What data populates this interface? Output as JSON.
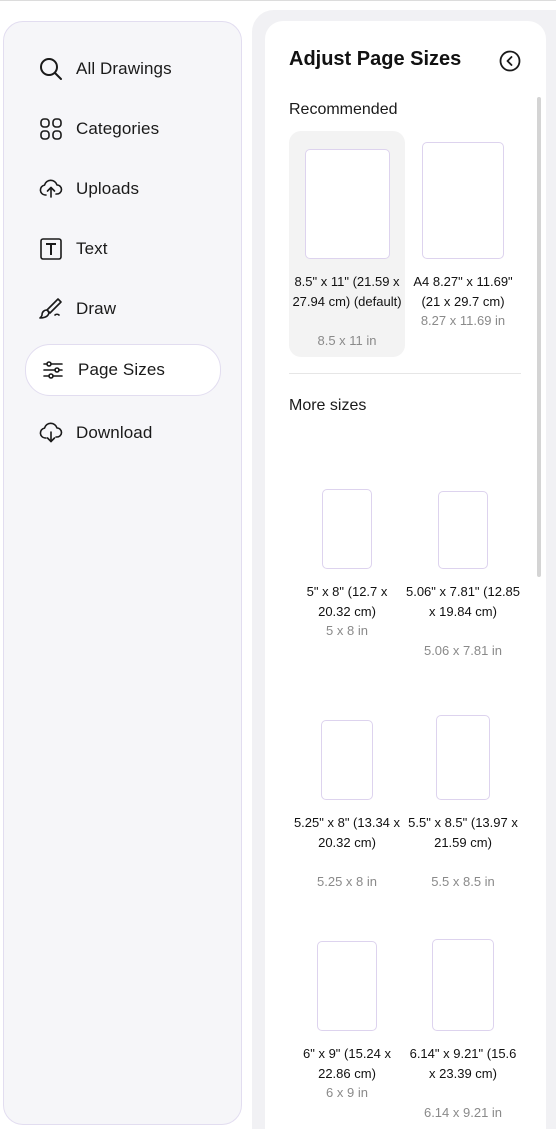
{
  "sidebar": {
    "items": [
      {
        "label": "All Drawings",
        "icon": "search-icon"
      },
      {
        "label": "Categories",
        "icon": "grid-icon"
      },
      {
        "label": "Uploads",
        "icon": "cloud-upload-icon"
      },
      {
        "label": "Text",
        "icon": "text-icon"
      },
      {
        "label": "Draw",
        "icon": "brush-icon"
      },
      {
        "label": "Page Sizes",
        "icon": "sliders-icon",
        "active": true
      },
      {
        "label": "Download",
        "icon": "cloud-download-icon"
      }
    ]
  },
  "panel": {
    "title": "Adjust Page Sizes",
    "close_icon": "back-circle-icon",
    "recommended_label": "Recommended",
    "more_label": "More sizes",
    "recommended": [
      {
        "name": "8.5\" x 11\" (21.59 x 27.94 cm) (default)",
        "dims": "8.5 x 11 in",
        "selected": true
      },
      {
        "name": "A4 8.27\" x 11.69\" (21 x 29.7 cm)",
        "dims": "8.27 x 11.69 in"
      }
    ],
    "more": [
      {
        "name": "5\" x 8\" (12.7 x 20.32 cm)",
        "dims": "5 x 8 in"
      },
      {
        "name": "5.06\" x 7.81\" (12.85 x 19.84 cm)",
        "dims": "5.06 x 7.81 in"
      },
      {
        "name": "5.25\" x 8\" (13.34 x 20.32 cm)",
        "dims": "5.25 x 8 in"
      },
      {
        "name": "5.5\" x 8.5\" (13.97 x 21.59 cm)",
        "dims": "5.5 x 8.5 in"
      },
      {
        "name": "6\" x 9\" (15.24 x 22.86 cm)",
        "dims": "6 x 9 in"
      },
      {
        "name": "6.14\" x 9.21\" (15.6 x 23.39 cm)",
        "dims": "6.14 x 9.21 in"
      }
    ]
  },
  "colors": {
    "page_border": "#ddd3ee",
    "sidebar_bg": "#f6f6f9",
    "sidebar_border": "#e2ddf0",
    "muted_text": "#8a8a8a"
  }
}
